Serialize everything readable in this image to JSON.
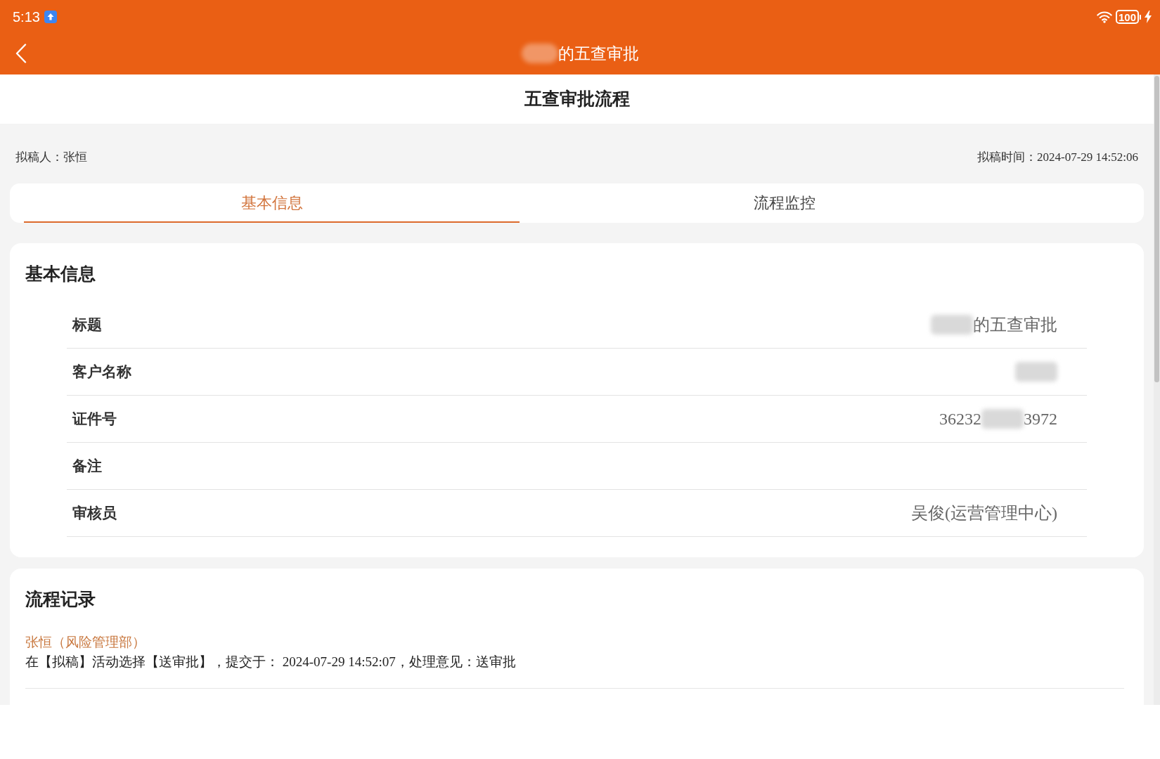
{
  "status_bar": {
    "time": "5:13",
    "battery": "100"
  },
  "nav_bar": {
    "title_parts": [
      {
        "kind": "blur"
      },
      {
        "kind": "text",
        "text": "的五查审批"
      }
    ]
  },
  "page_header": {
    "title": "五查审批流程"
  },
  "draft_info": {
    "drafter": "拟稿人：张恒",
    "draft_time": "拟稿时间：2024-07-29 14:52:06"
  },
  "tabs": [
    {
      "label": "基本信息",
      "selected": true
    },
    {
      "label": "流程监控",
      "selected": false
    }
  ],
  "basic_info": {
    "title": "基本信息",
    "fields": [
      {
        "label": "标题",
        "value_parts": [
          {
            "kind": "blur"
          },
          {
            "kind": "text",
            "text": "的五查审批"
          }
        ]
      },
      {
        "label": "客户名称",
        "value_parts": [
          {
            "kind": "blur"
          }
        ]
      },
      {
        "label": "证件号",
        "value_parts": [
          {
            "kind": "text",
            "text": "36232"
          },
          {
            "kind": "blur"
          },
          {
            "kind": "text",
            "text": "3972"
          }
        ]
      },
      {
        "label": "备注"
      },
      {
        "label": "审核员",
        "value_parts": [
          {
            "kind": "text",
            "text": "吴俊(运营管理中心)"
          }
        ]
      }
    ]
  },
  "process_record": {
    "title": "流程记录",
    "entries": [
      {
        "person": "张恒（风险管理部）",
        "detail": "在【拟稿】活动选择【送审批】，提交于： 2024-07-29 14:52:07，处理意见：送审批"
      }
    ]
  }
}
